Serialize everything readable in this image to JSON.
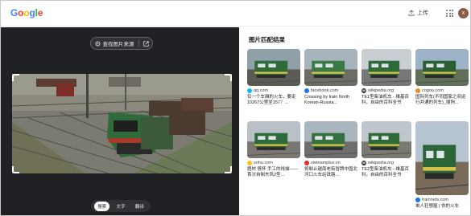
{
  "header": {
    "logo_letters": [
      {
        "ch": "G",
        "color": "#4285F4"
      },
      {
        "ch": "o",
        "color": "#EA4335"
      },
      {
        "ch": "o",
        "color": "#FBBC05"
      },
      {
        "ch": "g",
        "color": "#4285F4"
      },
      {
        "ch": "l",
        "color": "#34A853"
      },
      {
        "ch": "e",
        "color": "#EA4335"
      }
    ],
    "upload_label": "上传",
    "avatar_initial": "x"
  },
  "viewer": {
    "find_source_label": "查找图片来源",
    "modes": [
      "搜索",
      "文字",
      "翻译"
    ],
    "active_mode": "搜索"
  },
  "results": {
    "title": "图片匹配结果",
    "items": [
      {
        "source": "qq.com",
        "fav_color": "#12b7f5",
        "title": "仅一个车厢的火车，要走10267公里坐157？..."
      },
      {
        "source": "facebook.com",
        "fav_color": "#1877f2",
        "title": "Crossing by train North Korean-Russia..."
      },
      {
        "source": "wikipedia.org",
        "fav_color": "#333333",
        "fav_letter": "W",
        "title": "TE1型柴油机车 - 维基百科，自由的百科全书"
      },
      {
        "source": "cogou.com",
        "fav_color": "#f08a24",
        "title": "国际列车(不同国家之间运行并通的列车)_搜狗..."
      },
      {
        "source": "sohu.com",
        "fav_color": "#f5c518",
        "title": "题材 情怀 手工的线描——首次自制东风2型..."
      },
      {
        "source": "vietnamplus.vn",
        "fav_color": "#d93025",
        "title": "将制止越南老街冒牌中国北河口火车站铁路..."
      },
      {
        "source": "wikipedia.org",
        "fav_color": "#333333",
        "fav_letter": "W",
        "title": "TE2型柴油机车 - 维基百科，自由的百科全书"
      },
      {
        "source": "trainnets.com",
        "fav_color": "#1a73e8",
        "title": "单人狂想屋 | 你的火车"
      }
    ]
  },
  "colors": {
    "dark_panel": "#202124",
    "train_green": "#2f6b3a",
    "train_red": "#a83a2a"
  }
}
